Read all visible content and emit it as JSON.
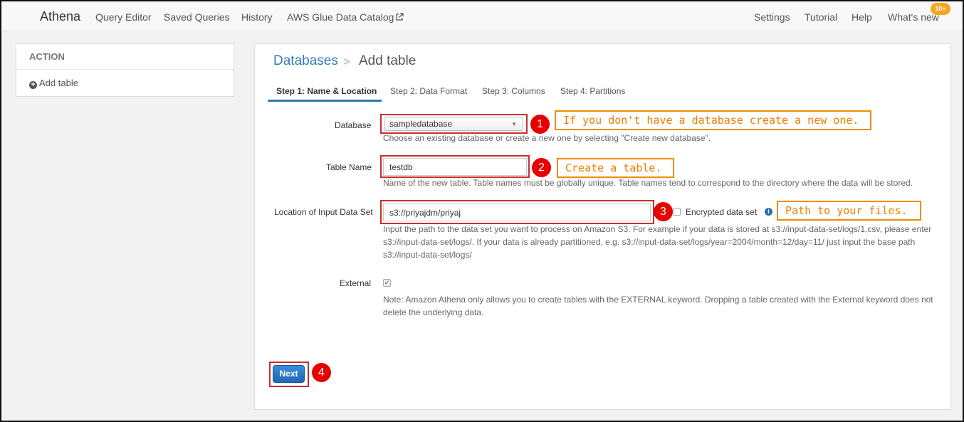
{
  "topnav": {
    "brand": "Athena",
    "links": [
      "Query Editor",
      "Saved Queries",
      "History",
      "AWS Glue Data Catalog"
    ],
    "right_links": [
      "Settings",
      "Tutorial",
      "Help",
      "What's new"
    ],
    "badge": "10+"
  },
  "sidebar": {
    "heading": "ACTION",
    "add_table": "Add table"
  },
  "breadcrumb": {
    "parent": "Databases",
    "separator": ">",
    "current": "Add table"
  },
  "tabs": [
    {
      "label": "Step 1: Name & Location",
      "active": true
    },
    {
      "label": "Step 2: Data Format",
      "active": false
    },
    {
      "label": "Step 3: Columns",
      "active": false
    },
    {
      "label": "Step 4: Partitions",
      "active": false
    }
  ],
  "form": {
    "database": {
      "label": "Database",
      "selected": "sampledatabase",
      "help": "Choose an existing database or create a new one by selecting \"Create new database\"."
    },
    "table_name": {
      "label": "Table Name",
      "value": "testdb",
      "help": "Name of the new table. Table names must be globally unique. Table names tend to correspond to the directory where the data will be stored."
    },
    "location": {
      "label": "Location of Input Data Set",
      "value": "s3://priyajdm/priyaj",
      "encrypted_label": "Encrypted data set",
      "encrypted_checked": false,
      "help_lines": [
        "Input the path to the data set you want to process on Amazon S3. For example if your data is stored at s3://input-data-set/logs/1.csv, please enter",
        "s3://input-data-set/logs/. If your data is already partitioned, e.g. s3://input-data-set/logs/year=2004/month=12/day=11/ just input the base path",
        "s3://input-data-set/logs/"
      ]
    },
    "external": {
      "label": "External",
      "checked": true,
      "note_lines": [
        "Note: Amazon Athena only allows you to create tables with the EXTERNAL keyword. Dropping a table created with the External keyword does not",
        "delete the underlying data."
      ]
    },
    "next_label": "Next"
  },
  "annotations": {
    "numbers": [
      "1",
      "2",
      "3",
      "4"
    ],
    "callouts": [
      "If you don't have a database create a new one.",
      "Create a table.",
      "Path to your files."
    ]
  },
  "colors": {
    "accent": "#337ab7",
    "annotation_red": "#e60000",
    "callout_orange": "#f08c00",
    "badge": "#f5a623"
  }
}
